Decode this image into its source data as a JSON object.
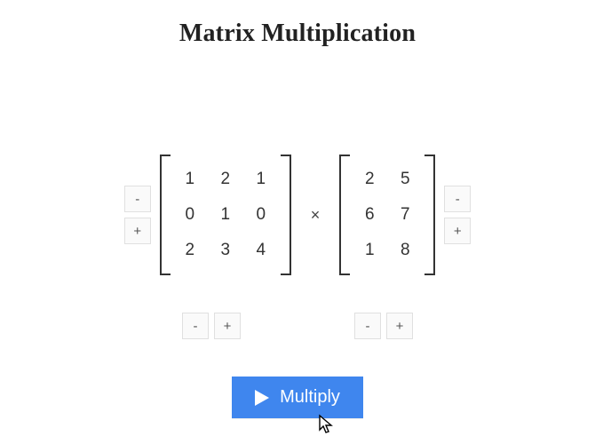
{
  "title": "Matrix Multiplication",
  "operator": "×",
  "controls": {
    "minus_label": "-",
    "plus_label": "+"
  },
  "matrices": {
    "A": {
      "rows": 3,
      "cols": 3,
      "values": [
        [
          1,
          2,
          1
        ],
        [
          0,
          1,
          0
        ],
        [
          2,
          3,
          4
        ]
      ]
    },
    "B": {
      "rows": 3,
      "cols": 2,
      "values": [
        [
          2,
          5
        ],
        [
          6,
          7
        ],
        [
          1,
          8
        ]
      ]
    }
  },
  "action": {
    "multiply_label": "Multiply"
  },
  "chart_data": {
    "type": "table",
    "title": "Matrix Multiplication",
    "operation": "A × B",
    "A": [
      [
        1,
        2,
        1
      ],
      [
        0,
        1,
        0
      ],
      [
        2,
        3,
        4
      ]
    ],
    "B": [
      [
        2,
        5
      ],
      [
        6,
        7
      ],
      [
        1,
        8
      ]
    ]
  }
}
